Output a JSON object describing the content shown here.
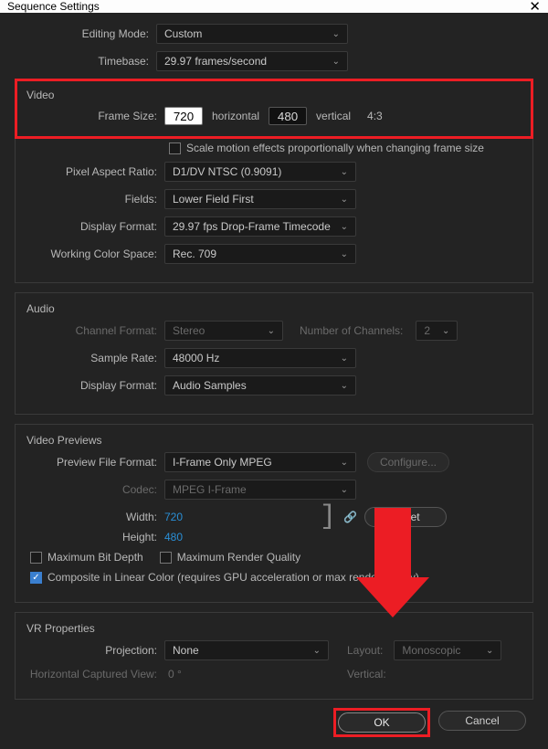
{
  "window": {
    "title": "Sequence Settings"
  },
  "top": {
    "editingMode": {
      "label": "Editing Mode:",
      "value": "Custom"
    },
    "timebase": {
      "label": "Timebase:",
      "value": "29.97  frames/second"
    }
  },
  "video": {
    "legend": "Video",
    "frameSize": {
      "label": "Frame Size:",
      "width": "720",
      "horizontal": "horizontal",
      "height": "480",
      "vertical": "vertical",
      "aspect": "4:3"
    },
    "scaleMotion": "Scale motion effects proportionally when changing frame size",
    "pixelAspect": {
      "label": "Pixel Aspect Ratio:",
      "value": "D1/DV NTSC (0.9091)"
    },
    "fields": {
      "label": "Fields:",
      "value": "Lower Field First"
    },
    "displayFormat": {
      "label": "Display Format:",
      "value": "29.97 fps Drop-Frame Timecode"
    },
    "workingColor": {
      "label": "Working Color Space:",
      "value": "Rec. 709"
    }
  },
  "audio": {
    "legend": "Audio",
    "channelFormat": {
      "label": "Channel Format:",
      "value": "Stereo"
    },
    "numChannels": {
      "label": "Number of Channels:",
      "value": "2"
    },
    "sampleRate": {
      "label": "Sample Rate:",
      "value": "48000 Hz"
    },
    "displayFormat": {
      "label": "Display Format:",
      "value": "Audio Samples"
    }
  },
  "previews": {
    "legend": "Video Previews",
    "fileFormat": {
      "label": "Preview File Format:",
      "value": "I-Frame Only MPEG"
    },
    "configure": "Configure...",
    "codec": {
      "label": "Codec:",
      "value": "MPEG I-Frame"
    },
    "width": {
      "label": "Width:",
      "value": "720"
    },
    "height": {
      "label": "Height:",
      "value": "480"
    },
    "reset": "Reset",
    "maxBitDepth": "Maximum Bit Depth",
    "maxRenderQuality": "Maximum Render Quality",
    "compositeLinear": "Composite in Linear Color (requires GPU acceleration or max render quality)"
  },
  "vr": {
    "legend": "VR Properties",
    "projection": {
      "label": "Projection:",
      "value": "None"
    },
    "layout": {
      "label": "Layout:",
      "value": "Monoscopic"
    },
    "horizView": {
      "label": "Horizontal Captured View:",
      "value": "0 °"
    },
    "vertView": {
      "label": "Vertical:"
    }
  },
  "footer": {
    "ok": "OK",
    "cancel": "Cancel"
  }
}
